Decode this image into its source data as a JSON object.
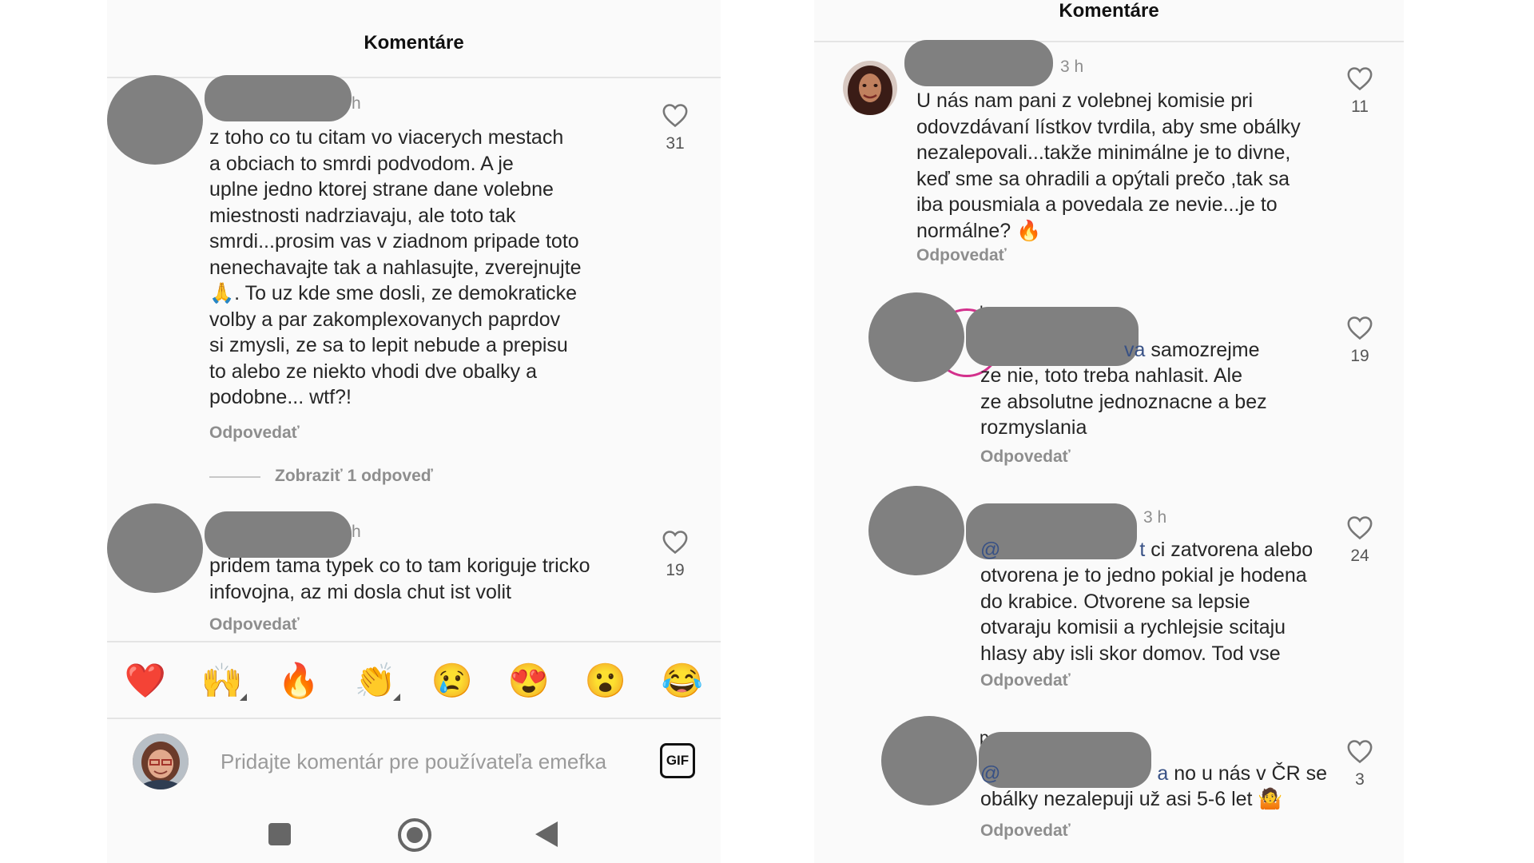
{
  "left": {
    "title": "Komentáre",
    "comments": [
      {
        "time": "h",
        "text": "z toho co tu citam vo viacerych mestach\na obciach to smrdi podvodom. A je\nuplne jedno ktorej strane dane volebne\nmiestnosti nadrziavaju, ale toto tak\nsmrdi...prosim vas v ziadnom pripade toto\nnenechavajte tak a nahlasujte, zverejnujte\n🙏. To uz kde sme dosli, ze demokraticke\nvolby a par zakomplexovanych paprdov\nsi zmysli, ze sa to lepit nebude a prepisu\nto alebo ze niekto vhodi dve obalky a\npodobne... wtf?!",
        "reply_label": "Odpovedať",
        "likes": "31",
        "show_replies": "Zobraziť 1 odpoveď"
      },
      {
        "time": "h",
        "text": "pridem tama typek co to tam koriguje tricko\ninfovojna, az mi dosla chut ist volit",
        "reply_label": "Odpovedať",
        "likes": "19"
      }
    ],
    "emoji_bar": [
      "❤️",
      "🙌",
      "🔥",
      "👏",
      "😢",
      "😍",
      "😮",
      "😂"
    ],
    "input": {
      "placeholder": "Pridajte komentár pre používateľa emefka",
      "gif_label": "GIF"
    }
  },
  "right": {
    "title": "Komentáre",
    "comments": [
      {
        "time": "3 h",
        "text": "U nás nam pani z volebnej komisie pri\nodovzdávaní  lístkov tvrdila, aby sme obálky\nnezalepovali...takže minimálne je to divne,\nkeď sme sa ohradili a opýtali prečo ,tak sa\niba pousmiala a povedala ze nevie...je to\nnormálne? 🔥",
        "reply_label": "Odpovedať",
        "likes": "11"
      },
      {
        "name_visible_fragment": "l",
        "mention_tail": "va",
        "text_first": " samozrejme",
        "text": "ze nie, toto treba nahlasit. Ale\nze absolutne jednoznacne a bez\nrozmyslania",
        "reply_label": "Odpovedať",
        "likes": "19"
      },
      {
        "time": "3 h",
        "mention_head": "@",
        "mention_tail": "t",
        "text_first": " ci zatvorena alebo",
        "text": "otvorena je to jedno pokial je hodena\ndo krabice. Otvorene sa lepsie\notvaraju komisii a rychlejsie scitaju\nhlasy aby isli skor domov. Tod vse",
        "reply_label": "Odpovedať",
        "likes": "24"
      },
      {
        "name_visible_fragment": "p",
        "mention_head": "@",
        "mention_tail": "a",
        "text_first": " no u nás v ČR se",
        "text": "obálky nezalepuji už asi 5-6 let 🤷",
        "reply_label": "Odpovedať",
        "likes": "3"
      }
    ]
  },
  "colors": {
    "redaction": "#808080",
    "secondary_text": "#8e8e8e",
    "mention": "#385185"
  }
}
